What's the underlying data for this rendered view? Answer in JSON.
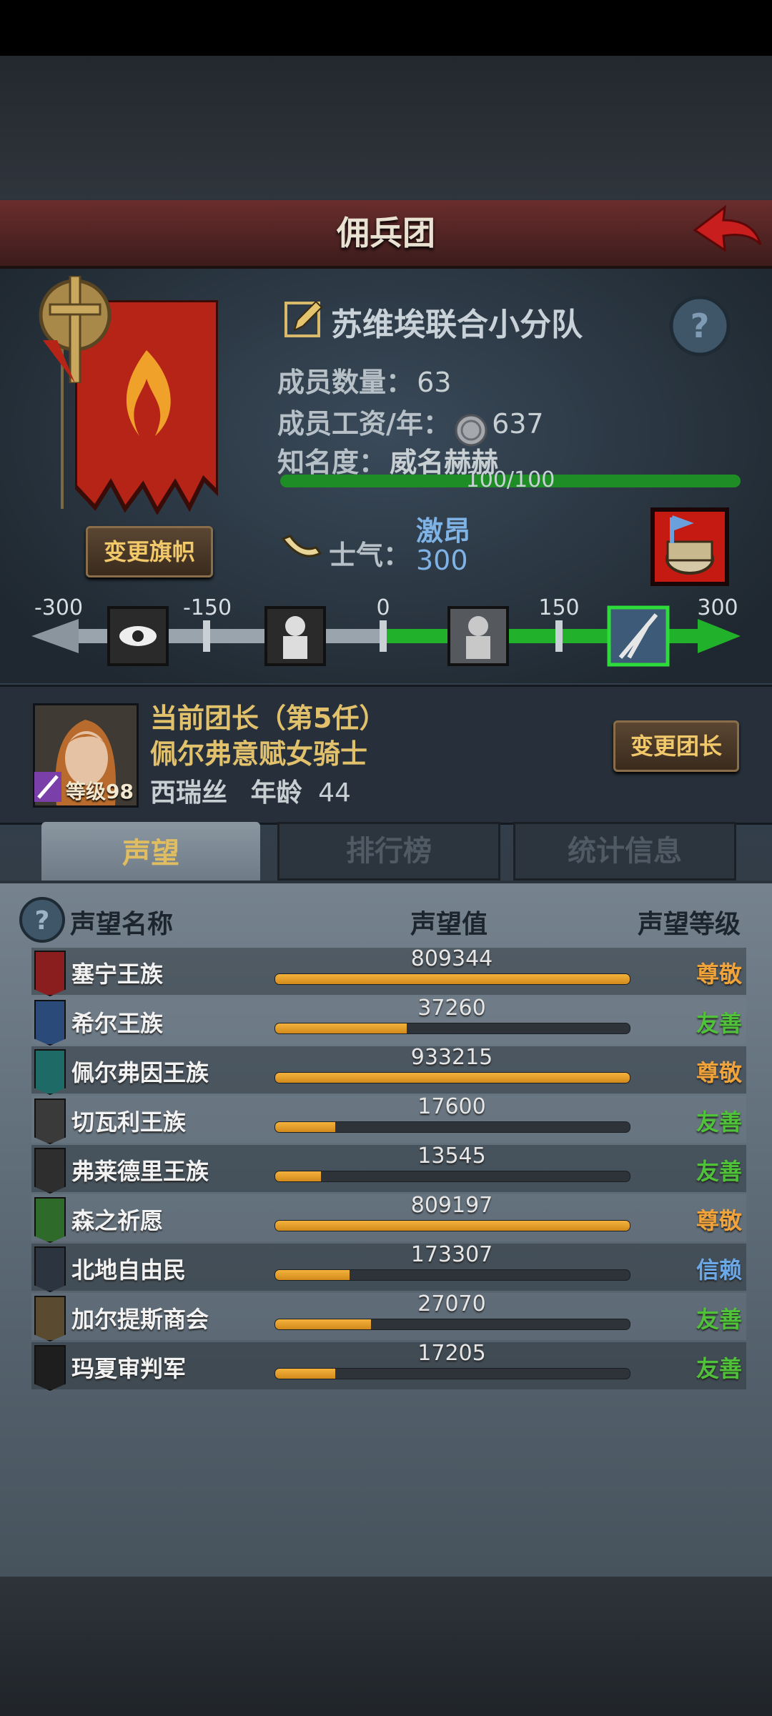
{
  "title": "佣兵团",
  "squad": {
    "name": "苏维埃联合小分队",
    "members_label": "成员数量：",
    "members": "63",
    "salary_label": "成员工资/年：",
    "salary": "637",
    "fame_label": "知名度：",
    "fame_title": "威名赫赫",
    "fame_text": "100/100",
    "fame_progress": 1.0,
    "change_banner": "变更旗帜"
  },
  "morale": {
    "label": "士气：",
    "state": "激昂",
    "value": "300",
    "scale": [
      "-300",
      "-150",
      "0",
      "150",
      "300"
    ],
    "current": 300
  },
  "leader": {
    "title": "当前团长（第5任）",
    "rank": "佩尔弗意赋女骑士",
    "name": "西瑞丝",
    "age_label": "年龄",
    "age": "44",
    "level_label": "等级98",
    "change_button": "变更团长"
  },
  "tabs": [
    {
      "label": "声望",
      "active": true
    },
    {
      "label": "排行榜",
      "active": false
    },
    {
      "label": "统计信息",
      "active": false
    }
  ],
  "rep_headers": {
    "name": "声望名称",
    "value": "声望值",
    "level": "声望等级"
  },
  "reputation": [
    {
      "name": "塞宁王族",
      "value": "809344",
      "progress": 1.0,
      "level": "尊敬",
      "level_color": "#f0a33a",
      "icon_color": "#8a1e1e"
    },
    {
      "name": "希尔王族",
      "value": "37260",
      "progress": 0.37,
      "level": "友善",
      "level_color": "#4fc23a",
      "icon_color": "#2a4a7a"
    },
    {
      "name": "佩尔弗因王族",
      "value": "933215",
      "progress": 1.0,
      "level": "尊敬",
      "level_color": "#f0a33a",
      "icon_color": "#1e6a66"
    },
    {
      "name": "切瓦利王族",
      "value": "17600",
      "progress": 0.17,
      "level": "友善",
      "level_color": "#4fc23a",
      "icon_color": "#3a3a3a"
    },
    {
      "name": "弗莱德里王族",
      "value": "13545",
      "progress": 0.13,
      "level": "友善",
      "level_color": "#4fc23a",
      "icon_color": "#2e2e2e"
    },
    {
      "name": "森之祈愿",
      "value": "809197",
      "progress": 1.0,
      "level": "尊敬",
      "level_color": "#f0a33a",
      "icon_color": "#2e6a2a"
    },
    {
      "name": "北地自由民",
      "value": "173307",
      "progress": 0.21,
      "level": "信赖",
      "level_color": "#6aa8e8",
      "icon_color": "#2c3440"
    },
    {
      "name": "加尔提斯商会",
      "value": "27070",
      "progress": 0.27,
      "level": "友善",
      "level_color": "#4fc23a",
      "icon_color": "#5a4a30"
    },
    {
      "name": "玛夏审判军",
      "value": "17205",
      "progress": 0.17,
      "level": "友善",
      "level_color": "#4fc23a",
      "icon_color": "#1e1e1e"
    }
  ]
}
